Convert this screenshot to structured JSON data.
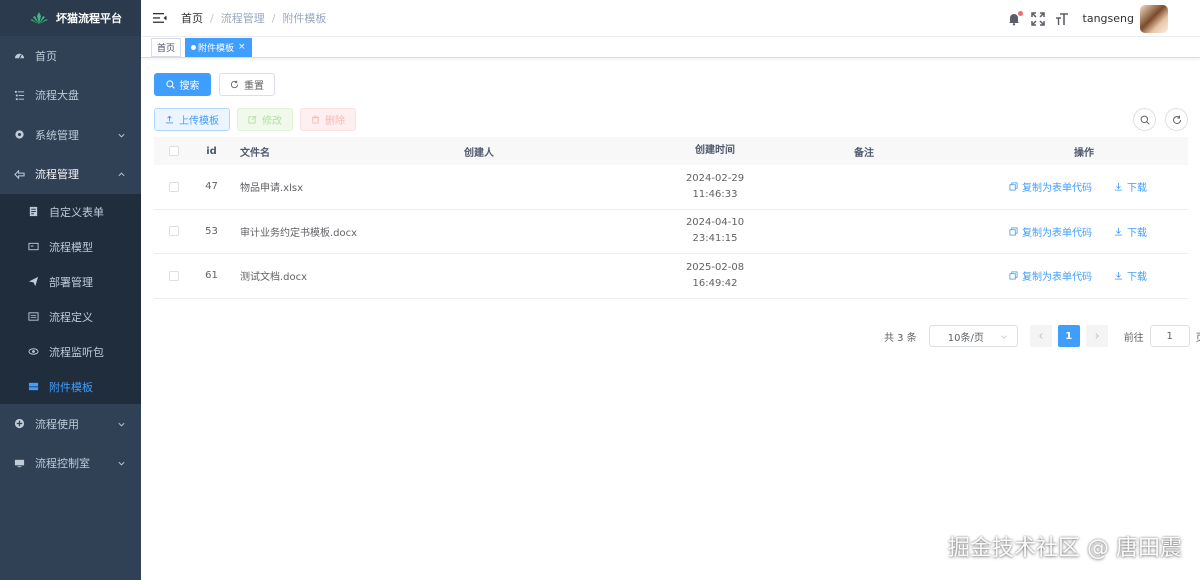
{
  "app": {
    "title": "坏猫流程平台"
  },
  "sidebar": {
    "items": [
      {
        "label": "首页",
        "icon": "dashboard-icon"
      },
      {
        "label": "流程大盘",
        "icon": "list-icon"
      },
      {
        "label": "系统管理",
        "icon": "gear-icon"
      },
      {
        "label": "流程管理",
        "icon": "flow-icon"
      }
    ],
    "submenu": [
      {
        "label": "自定义表单",
        "icon": "form-icon"
      },
      {
        "label": "流程模型",
        "icon": "model-icon"
      },
      {
        "label": "部署管理",
        "icon": "send-icon"
      },
      {
        "label": "流程定义",
        "icon": "definition-icon"
      },
      {
        "label": "流程监听包",
        "icon": "eye-icon"
      },
      {
        "label": "附件模板",
        "icon": "attachment-icon"
      }
    ],
    "bottom_items": [
      {
        "label": "流程使用",
        "icon": "use-icon"
      },
      {
        "label": "流程控制室",
        "icon": "monitor-icon"
      }
    ],
    "accent_color": "#409eff"
  },
  "navbar": {
    "breadcrumb": [
      "首页",
      "流程管理",
      "附件模板"
    ],
    "separator": "/",
    "username": "tangseng"
  },
  "tags": [
    {
      "label": "首页",
      "active": false
    },
    {
      "label": "附件模板",
      "active": true,
      "close": "×"
    }
  ],
  "toolbar": {
    "search_label": "搜索",
    "reset_label": "重置",
    "upload_label": "上传模板",
    "edit_label": "修改",
    "delete_label": "删除"
  },
  "table": {
    "columns": [
      "id",
      "文件名",
      "创建人",
      "创建时间",
      "备注",
      "操作"
    ],
    "rows": [
      {
        "id": "47",
        "name": "物品申请.xlsx",
        "creator": "",
        "date": "2024-02-29",
        "time": "11:46:33",
        "note": ""
      },
      {
        "id": "53",
        "name": "审计业务约定书模板.docx",
        "creator": "",
        "date": "2024-04-10",
        "time": "23:41:15",
        "note": ""
      },
      {
        "id": "61",
        "name": "测试文档.docx",
        "creator": "",
        "date": "2025-02-08",
        "time": "16:49:42",
        "note": ""
      }
    ],
    "actions": {
      "copy_label": "复制为表单代码",
      "download_label": "下载"
    }
  },
  "pagination": {
    "total_label": "共 3 条",
    "page_size": "10条/页",
    "current_page": "1",
    "goto_label": "前往",
    "goto_value": "1",
    "page_suffix": "页"
  },
  "watermark": "掘金技术社区 @ 唐田震"
}
